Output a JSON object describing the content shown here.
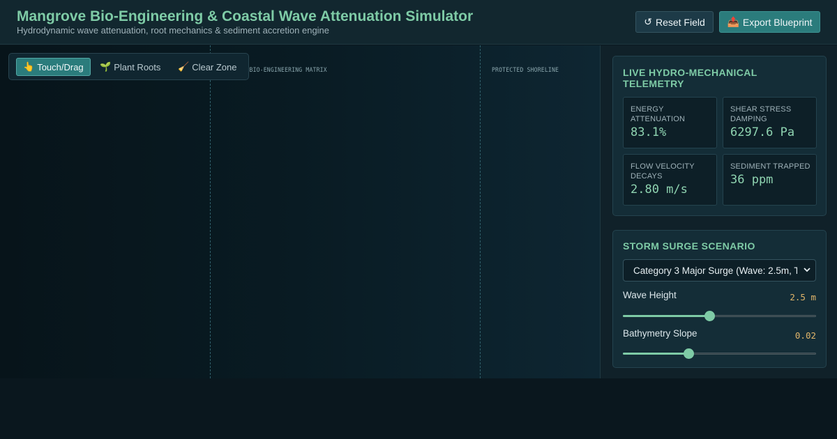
{
  "header": {
    "title": "Mangrove Bio-Engineering & Coastal Wave Attenuation Simulator",
    "subtitle": "Hydrodynamic wave attenuation, root mechanics & sediment accretion engine",
    "reset_icon": "↺",
    "reset_label": "Reset Field",
    "export_icon": "📤",
    "export_label": "Export Blueprint"
  },
  "canvas": {
    "zone_labels": [
      "MANGROVE BIO-ENGINEERING MATRIX",
      "PROTECTED SHORELINE"
    ],
    "tools": [
      {
        "icon": "👆",
        "label": "Touch/Drag",
        "active": true
      },
      {
        "icon": "🌱",
        "label": "Plant Roots",
        "active": false
      },
      {
        "icon": "🧹",
        "label": "Clear Zone",
        "active": false
      }
    ]
  },
  "telemetry": {
    "title": "LIVE HYDRO-MECHANICAL TELEMETRY",
    "metrics": [
      {
        "label": "ENERGY ATTENUATION",
        "value": "83.1%"
      },
      {
        "label": "SHEAR STRESS DAMPING",
        "value": "6297.6 Pa"
      },
      {
        "label": "FLOW VELOCITY DECAYS",
        "value": "2.80 m/s"
      },
      {
        "label": "SEDIMENT TRAPPED",
        "value": "36 ppm"
      }
    ]
  },
  "scenario": {
    "title": "STORM SURGE SCENARIO",
    "selected": "Category 3 Major Surge (Wave: 2.5m, T",
    "wave_height": {
      "label": "Wave Height",
      "value": "2.5 m",
      "fraction": 0.45
    },
    "bathymetry_slope": {
      "label": "Bathymetry Slope",
      "value": "0.02",
      "fraction": 0.34
    }
  },
  "colors": {
    "accent": "#7ecba6",
    "button_primary": "#2b7c7c",
    "value_amber": "#e0b56a"
  }
}
